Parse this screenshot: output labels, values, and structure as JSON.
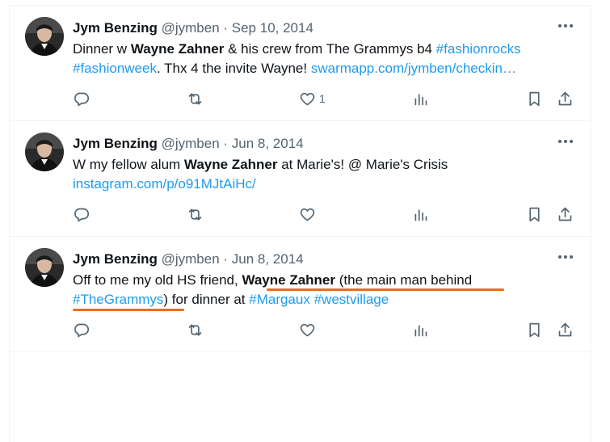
{
  "tweets": [
    {
      "author": "Jym Benzing",
      "handle": "@jymben",
      "sep": " · ",
      "date": "Sep 10, 2014",
      "line1": {
        "p1": "Dinner w ",
        "b1": "Wayne Zahner",
        "p2": " & his crew from The Grammys b4 ",
        "l1": "#fashionrocks"
      },
      "line2": {
        "l1": "#fashionweek",
        "p1": ". Thx 4 the invite Wayne! ",
        "l2": "swarmapp.com/jymben/checkin…"
      },
      "like_count": "1"
    },
    {
      "author": "Jym Benzing",
      "handle": "@jymben",
      "sep": " · ",
      "date": "Jun 8, 2014",
      "line1": {
        "p1": "W my fellow alum ",
        "b1": "Wayne Zahner",
        "p2": " at Marie's! @ Marie's Crisis"
      },
      "line2": {
        "l1": "instagram.com/p/o91MJtAiHc/"
      },
      "like_count": ""
    },
    {
      "author": "Jym Benzing",
      "handle": "@jymben",
      "sep": " · ",
      "date": "Jun 8, 2014",
      "line1": {
        "p1": "Off to me my old HS friend, ",
        "b1": "Wayne Zahner",
        "p2": " (the main man behind"
      },
      "line2": {
        "l1": "#TheGrammys",
        "p1": ") for dinner at ",
        "l2": "#Margaux",
        "p2": " ",
        "l3": "#westvillage"
      },
      "like_count": ""
    }
  ],
  "icons": [
    "more-icon",
    "reply-icon",
    "retweet-icon",
    "like-icon",
    "views-icon",
    "bookmark-icon",
    "share-icon"
  ],
  "colors": {
    "link": "#1d9bf0",
    "muted": "#536471",
    "annotation": "#ec6d1c",
    "divider": "#eff3f4"
  }
}
